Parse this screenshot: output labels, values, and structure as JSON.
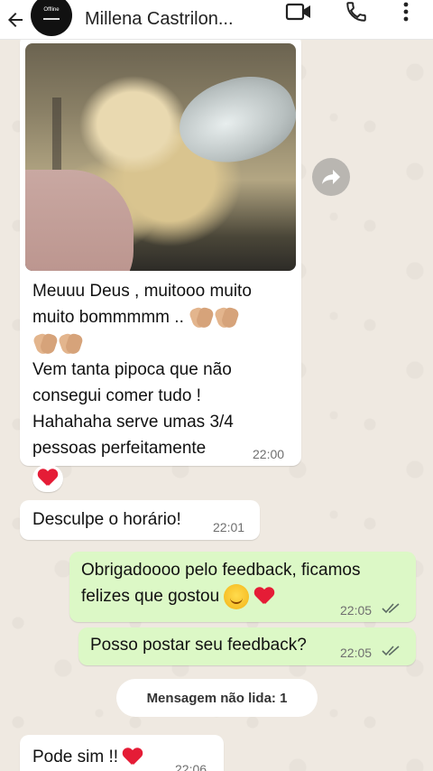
{
  "header": {
    "contact_name": "Millena Castrilon...",
    "avatar_text": "Offline"
  },
  "messages": {
    "praise": {
      "line1": "Meuuu Deus , muitooo muito",
      "line2": "muito bommmmm ..",
      "line3": "Vem tanta pipoca que não",
      "line4": "consegui comer tudo !",
      "line5": "Hahahaha serve umas 3/4",
      "line6": "pessoas perfeitamente",
      "time": "22:00"
    },
    "apology": {
      "text": "Desculpe o horário!",
      "time": "22:01"
    },
    "thanks": {
      "line1": "Obrigadoooo pelo feedback, ficamos",
      "line2": "felizes que gostou",
      "time": "22:05"
    },
    "ask_post": {
      "text": "Posso postar seu feedback?",
      "time": "22:05"
    },
    "unread_banner": "Mensagem não lida: 1",
    "reply": {
      "text": "Pode sim !!",
      "time": "22:06"
    }
  },
  "colors": {
    "incoming": "#ffffff",
    "outgoing": "#dcf8c6",
    "heart": "#e51c36",
    "read_ticks": "#5c6b63"
  }
}
